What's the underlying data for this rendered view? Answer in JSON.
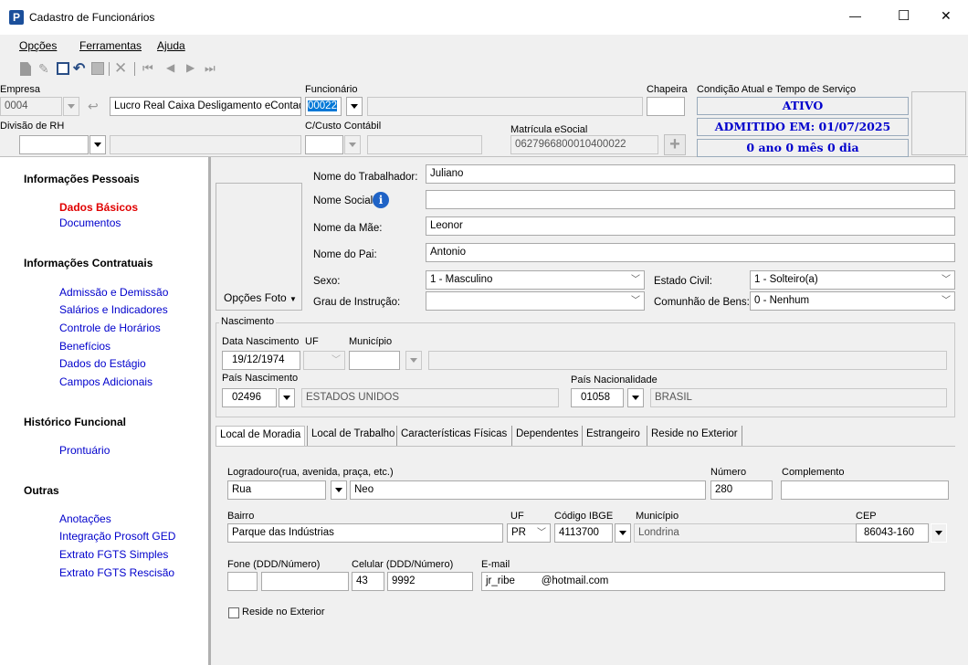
{
  "window": {
    "title": "Cadastro de Funcionários",
    "minimize": "—",
    "maximize": "☐",
    "close": "✕"
  },
  "menu": {
    "opcoes": "Opções",
    "ferramentas": "Ferramentas",
    "ajuda": "Ajuda"
  },
  "header": {
    "empresa_label": "Empresa",
    "empresa_code": "0004",
    "empresa_name": "Lucro Real Caixa Desligamento eContad",
    "funcionario_label": "Funcionário",
    "funcionario_code": "00022",
    "funcionario_name": "",
    "chapeira_label": "Chapeira",
    "chapeira_value": "",
    "condicao_label": "Condição Atual e Tempo de Serviço",
    "status_ativo": "ATIVO",
    "status_admitido": "ADMITIDO EM: 01/07/2025",
    "status_tempo": "0 ano 0 mês 0 dia",
    "divisao_label": "Divisão de RH",
    "divisao_code": "",
    "divisao_name": "",
    "ccusto_label": "C/Custo Contábil",
    "ccusto_code": "",
    "ccusto_name": "",
    "matricula_label": "Matrícula eSocial",
    "matricula_value": "0627966800010400022"
  },
  "sidebar": {
    "pessoais_title": "Informações Pessoais",
    "pessoais": [
      "Dados Básicos",
      "Documentos"
    ],
    "contratuais_title": "Informações Contratuais",
    "contratuais": [
      "Admissão e Demissão",
      "Salários e Indicadores",
      "Controle de Horários",
      "Benefícios",
      "Dados do Estágio",
      "Campos Adicionais"
    ],
    "historico_title": "Histórico Funcional",
    "historico": [
      "Prontuário"
    ],
    "outras_title": "Outras",
    "outras": [
      "Anotações",
      "Integração Prosoft GED",
      "Extrato FGTS Simples",
      "Extrato FGTS Rescisão"
    ]
  },
  "form": {
    "opcoes_foto": "Opções Foto",
    "nome_trab_label": "Nome do Trabalhador:",
    "nome_trab": "Juliano",
    "nome_social_label": "Nome Social:",
    "nome_social": "",
    "nome_mae_label": "Nome da Mãe:",
    "nome_mae": "Leonor",
    "nome_pai_label": "Nome do Pai:",
    "nome_pai": "Antonio",
    "sexo_label": "Sexo:",
    "sexo": "1 - Masculino",
    "estado_civil_label": "Estado Civil:",
    "estado_civil": "1 - Solteiro(a)",
    "grau_label": "Grau de Instrução:",
    "grau": "",
    "comunhao_label": "Comunhão de Bens:",
    "comunhao": "0 - Nenhum"
  },
  "nascimento": {
    "group_label": "Nascimento",
    "data_label": "Data Nascimento",
    "data": "19/12/1974",
    "uf_label": "UF",
    "uf": "",
    "municipio_label": "Município",
    "municipio_code": "",
    "municipio_name": "",
    "pais_nasc_label": "País Nascimento",
    "pais_nasc_code": "02496",
    "pais_nasc_name": "ESTADOS UNIDOS",
    "pais_nac_label": "País Nacionalidade",
    "pais_nac_code": "01058",
    "pais_nac_name": "BRASIL"
  },
  "tabs": [
    "Local de Moradia",
    "Local de Trabalho",
    "Características Físicas",
    "Dependentes",
    "Estrangeiro",
    "Reside no Exterior"
  ],
  "moradia": {
    "logradouro_label": "Logradouro(rua, avenida, praça, etc.)",
    "logradouro_tipo": "Rua",
    "logradouro_nome": "Neo",
    "numero_label": "Número",
    "numero": "280",
    "complemento_label": "Complemento",
    "complemento": "",
    "bairro_label": "Bairro",
    "bairro": "Parque das Indústrias",
    "uf_label": "UF",
    "uf": "PR",
    "ibge_label": "Código IBGE",
    "ibge": "4113700",
    "municipio_label": "Município",
    "municipio": "Londrina",
    "cep_label": "CEP",
    "cep": "86043-160",
    "fone_label": "Fone (DDD/Número)",
    "fone_ddd": "",
    "fone_num": "",
    "celular_label": "Celular (DDD/Número)",
    "cel_ddd": "43",
    "cel_num": "9992",
    "email_label": "E-mail",
    "email": "jr_ribe         @hotmail.com",
    "reside_exterior_label": "Reside no Exterior"
  },
  "colors": {
    "link": "#0000cc",
    "active_link": "#e00000",
    "panel": "#f0f0f0"
  }
}
